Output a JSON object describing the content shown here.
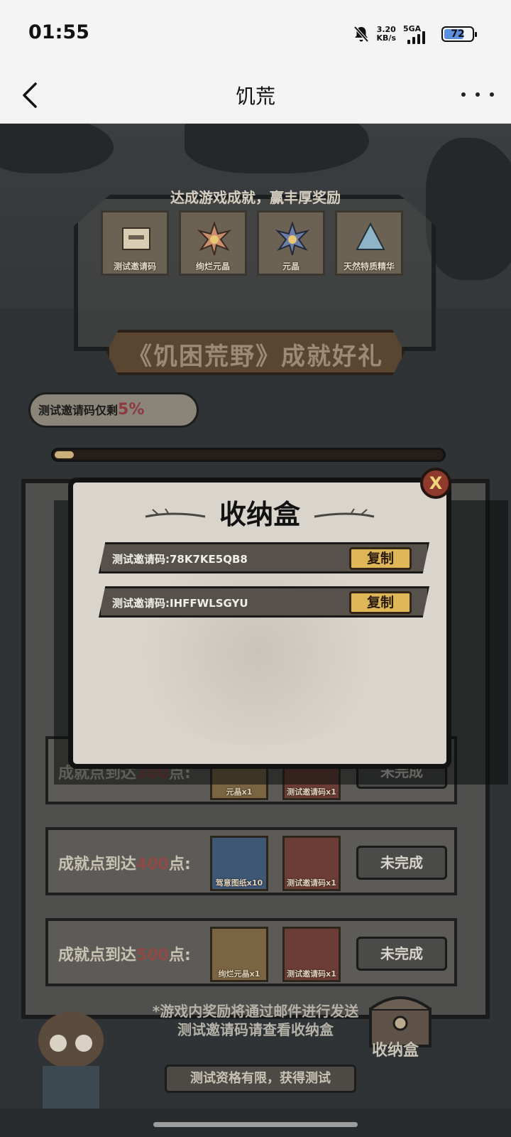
{
  "status": {
    "time": "01:55",
    "speed": "3.20",
    "speed_unit": "KB/s",
    "network": "5GA",
    "battery": "72"
  },
  "header": {
    "title": "饥荒"
  },
  "game": {
    "achievement_title": "达成游戏成就，赢丰厚奖励",
    "top_rewards": [
      {
        "label": "测试邀请码"
      },
      {
        "label": "绚烂元晶"
      },
      {
        "label": "元晶"
      },
      {
        "label": "天然特质精华"
      }
    ],
    "banner": "《饥困荒野》成就好礼",
    "bubble_prefix": "测试邀请码仅剩",
    "bubble_value": "5%",
    "progress_fraction": 0.05,
    "rows": [
      {
        "label_prefix": "成就点到达",
        "points": "300",
        "label_suffix": "点:",
        "item1": "元晶x1",
        "item2": "测试邀请码x1",
        "status": "未完成"
      },
      {
        "label_prefix": "成就点到达",
        "points": "400",
        "label_suffix": "点:",
        "item1": "驾意图纸x10",
        "item2": "测试邀请码x1",
        "status": "未完成"
      },
      {
        "label_prefix": "成就点到达",
        "points": "500",
        "label_suffix": "点:",
        "item1": "绚烂元晶x1",
        "item2": "测试邀请码x1",
        "status": "未完成"
      }
    ],
    "footer_line1": "*游戏内奖励将通过邮件进行发送",
    "footer_line2": "测试邀请码请查看收纳盒",
    "chest_label": "收纳盒",
    "ribbon": "测试资格有限，获得测试"
  },
  "modal": {
    "title": "收纳盒",
    "close": "X",
    "codes": [
      {
        "text": "测试邀请码:78K7KE5QB8",
        "button": "复制"
      },
      {
        "text": "测试邀请码:IHFFWLSGYU",
        "button": "复制"
      }
    ]
  },
  "colors": {
    "accent_gold": "#dfb758",
    "close_red": "#8f3a2c",
    "highlight_red": "#8e4a44"
  }
}
